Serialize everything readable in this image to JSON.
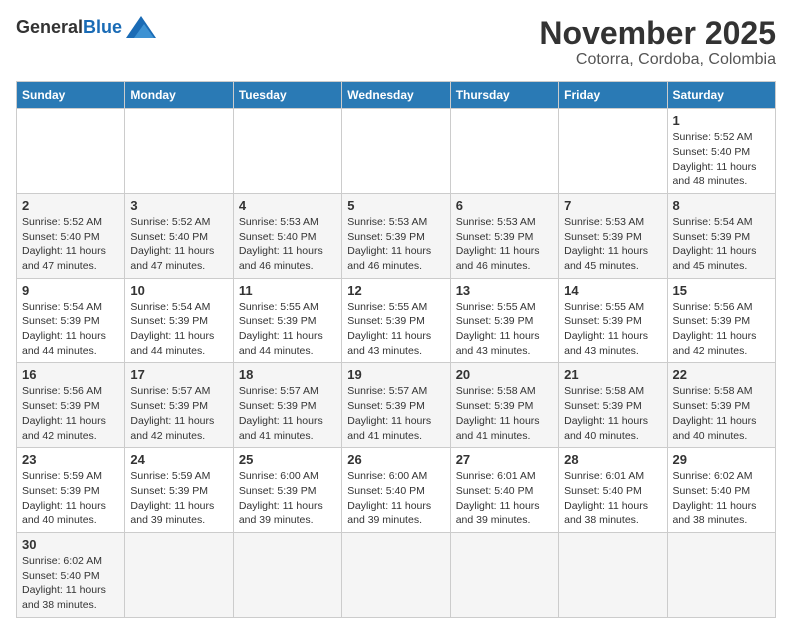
{
  "header": {
    "logo_text_general": "General",
    "logo_text_blue": "Blue",
    "title": "November 2025",
    "subtitle": "Cotorra, Cordoba, Colombia"
  },
  "weekdays": [
    "Sunday",
    "Monday",
    "Tuesday",
    "Wednesday",
    "Thursday",
    "Friday",
    "Saturday"
  ],
  "rows": [
    [
      {
        "day": "",
        "sunrise": "",
        "sunset": "",
        "daylight": ""
      },
      {
        "day": "",
        "sunrise": "",
        "sunset": "",
        "daylight": ""
      },
      {
        "day": "",
        "sunrise": "",
        "sunset": "",
        "daylight": ""
      },
      {
        "day": "",
        "sunrise": "",
        "sunset": "",
        "daylight": ""
      },
      {
        "day": "",
        "sunrise": "",
        "sunset": "",
        "daylight": ""
      },
      {
        "day": "",
        "sunrise": "",
        "sunset": "",
        "daylight": ""
      },
      {
        "day": "1",
        "sunrise": "Sunrise: 5:52 AM",
        "sunset": "Sunset: 5:40 PM",
        "daylight": "Daylight: 11 hours and 48 minutes."
      }
    ],
    [
      {
        "day": "2",
        "sunrise": "Sunrise: 5:52 AM",
        "sunset": "Sunset: 5:40 PM",
        "daylight": "Daylight: 11 hours and 47 minutes."
      },
      {
        "day": "3",
        "sunrise": "Sunrise: 5:52 AM",
        "sunset": "Sunset: 5:40 PM",
        "daylight": "Daylight: 11 hours and 47 minutes."
      },
      {
        "day": "4",
        "sunrise": "Sunrise: 5:53 AM",
        "sunset": "Sunset: 5:40 PM",
        "daylight": "Daylight: 11 hours and 46 minutes."
      },
      {
        "day": "5",
        "sunrise": "Sunrise: 5:53 AM",
        "sunset": "Sunset: 5:39 PM",
        "daylight": "Daylight: 11 hours and 46 minutes."
      },
      {
        "day": "6",
        "sunrise": "Sunrise: 5:53 AM",
        "sunset": "Sunset: 5:39 PM",
        "daylight": "Daylight: 11 hours and 46 minutes."
      },
      {
        "day": "7",
        "sunrise": "Sunrise: 5:53 AM",
        "sunset": "Sunset: 5:39 PM",
        "daylight": "Daylight: 11 hours and 45 minutes."
      },
      {
        "day": "8",
        "sunrise": "Sunrise: 5:54 AM",
        "sunset": "Sunset: 5:39 PM",
        "daylight": "Daylight: 11 hours and 45 minutes."
      }
    ],
    [
      {
        "day": "9",
        "sunrise": "Sunrise: 5:54 AM",
        "sunset": "Sunset: 5:39 PM",
        "daylight": "Daylight: 11 hours and 44 minutes."
      },
      {
        "day": "10",
        "sunrise": "Sunrise: 5:54 AM",
        "sunset": "Sunset: 5:39 PM",
        "daylight": "Daylight: 11 hours and 44 minutes."
      },
      {
        "day": "11",
        "sunrise": "Sunrise: 5:55 AM",
        "sunset": "Sunset: 5:39 PM",
        "daylight": "Daylight: 11 hours and 44 minutes."
      },
      {
        "day": "12",
        "sunrise": "Sunrise: 5:55 AM",
        "sunset": "Sunset: 5:39 PM",
        "daylight": "Daylight: 11 hours and 43 minutes."
      },
      {
        "day": "13",
        "sunrise": "Sunrise: 5:55 AM",
        "sunset": "Sunset: 5:39 PM",
        "daylight": "Daylight: 11 hours and 43 minutes."
      },
      {
        "day": "14",
        "sunrise": "Sunrise: 5:55 AM",
        "sunset": "Sunset: 5:39 PM",
        "daylight": "Daylight: 11 hours and 43 minutes."
      },
      {
        "day": "15",
        "sunrise": "Sunrise: 5:56 AM",
        "sunset": "Sunset: 5:39 PM",
        "daylight": "Daylight: 11 hours and 42 minutes."
      }
    ],
    [
      {
        "day": "16",
        "sunrise": "Sunrise: 5:56 AM",
        "sunset": "Sunset: 5:39 PM",
        "daylight": "Daylight: 11 hours and 42 minutes."
      },
      {
        "day": "17",
        "sunrise": "Sunrise: 5:57 AM",
        "sunset": "Sunset: 5:39 PM",
        "daylight": "Daylight: 11 hours and 42 minutes."
      },
      {
        "day": "18",
        "sunrise": "Sunrise: 5:57 AM",
        "sunset": "Sunset: 5:39 PM",
        "daylight": "Daylight: 11 hours and 41 minutes."
      },
      {
        "day": "19",
        "sunrise": "Sunrise: 5:57 AM",
        "sunset": "Sunset: 5:39 PM",
        "daylight": "Daylight: 11 hours and 41 minutes."
      },
      {
        "day": "20",
        "sunrise": "Sunrise: 5:58 AM",
        "sunset": "Sunset: 5:39 PM",
        "daylight": "Daylight: 11 hours and 41 minutes."
      },
      {
        "day": "21",
        "sunrise": "Sunrise: 5:58 AM",
        "sunset": "Sunset: 5:39 PM",
        "daylight": "Daylight: 11 hours and 40 minutes."
      },
      {
        "day": "22",
        "sunrise": "Sunrise: 5:58 AM",
        "sunset": "Sunset: 5:39 PM",
        "daylight": "Daylight: 11 hours and 40 minutes."
      }
    ],
    [
      {
        "day": "23",
        "sunrise": "Sunrise: 5:59 AM",
        "sunset": "Sunset: 5:39 PM",
        "daylight": "Daylight: 11 hours and 40 minutes."
      },
      {
        "day": "24",
        "sunrise": "Sunrise: 5:59 AM",
        "sunset": "Sunset: 5:39 PM",
        "daylight": "Daylight: 11 hours and 39 minutes."
      },
      {
        "day": "25",
        "sunrise": "Sunrise: 6:00 AM",
        "sunset": "Sunset: 5:39 PM",
        "daylight": "Daylight: 11 hours and 39 minutes."
      },
      {
        "day": "26",
        "sunrise": "Sunrise: 6:00 AM",
        "sunset": "Sunset: 5:40 PM",
        "daylight": "Daylight: 11 hours and 39 minutes."
      },
      {
        "day": "27",
        "sunrise": "Sunrise: 6:01 AM",
        "sunset": "Sunset: 5:40 PM",
        "daylight": "Daylight: 11 hours and 39 minutes."
      },
      {
        "day": "28",
        "sunrise": "Sunrise: 6:01 AM",
        "sunset": "Sunset: 5:40 PM",
        "daylight": "Daylight: 11 hours and 38 minutes."
      },
      {
        "day": "29",
        "sunrise": "Sunrise: 6:02 AM",
        "sunset": "Sunset: 5:40 PM",
        "daylight": "Daylight: 11 hours and 38 minutes."
      }
    ],
    [
      {
        "day": "30",
        "sunrise": "Sunrise: 6:02 AM",
        "sunset": "Sunset: 5:40 PM",
        "daylight": "Daylight: 11 hours and 38 minutes."
      },
      {
        "day": "",
        "sunrise": "",
        "sunset": "",
        "daylight": ""
      },
      {
        "day": "",
        "sunrise": "",
        "sunset": "",
        "daylight": ""
      },
      {
        "day": "",
        "sunrise": "",
        "sunset": "",
        "daylight": ""
      },
      {
        "day": "",
        "sunrise": "",
        "sunset": "",
        "daylight": ""
      },
      {
        "day": "",
        "sunrise": "",
        "sunset": "",
        "daylight": ""
      },
      {
        "day": "",
        "sunrise": "",
        "sunset": "",
        "daylight": ""
      }
    ]
  ]
}
